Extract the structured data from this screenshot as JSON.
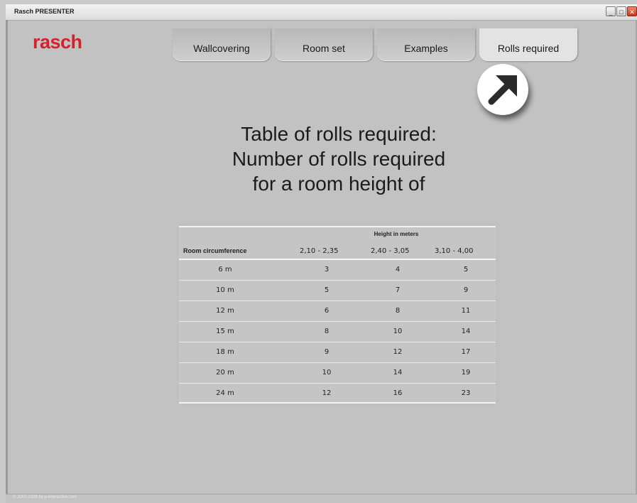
{
  "window": {
    "title": "Rasch PRESENTER",
    "minimize": "_",
    "maximize": "□",
    "close": "✕"
  },
  "logo": "rasch",
  "tabs": [
    {
      "label": "Wallcovering",
      "active": false
    },
    {
      "label": "Room set",
      "active": false
    },
    {
      "label": "Examples",
      "active": false
    },
    {
      "label": "Rolls required",
      "active": true
    }
  ],
  "arrow_icon": "arrow-up-right-icon",
  "heading": [
    "Table of rolls required:",
    "Number of rolls required",
    "for a room height of"
  ],
  "table": {
    "group_header": "Height in meters",
    "columns": [
      "Room circumference",
      "2,10 - 2,35",
      "2,40 - 3,05",
      "3,10 - 4,00"
    ],
    "rows": [
      [
        "6 m",
        "3",
        "4",
        "5"
      ],
      [
        "10 m",
        "5",
        "7",
        "9"
      ],
      [
        "12 m",
        "6",
        "8",
        "11"
      ],
      [
        "15 m",
        "8",
        "10",
        "14"
      ],
      [
        "18 m",
        "9",
        "12",
        "17"
      ],
      [
        "20 m",
        "10",
        "14",
        "19"
      ],
      [
        "24 m",
        "12",
        "16",
        "23"
      ]
    ]
  },
  "footer": "© 2007-2008 by p-interactive.com",
  "colors": {
    "logo": "#d6202b",
    "background": "#c2c2c2"
  }
}
